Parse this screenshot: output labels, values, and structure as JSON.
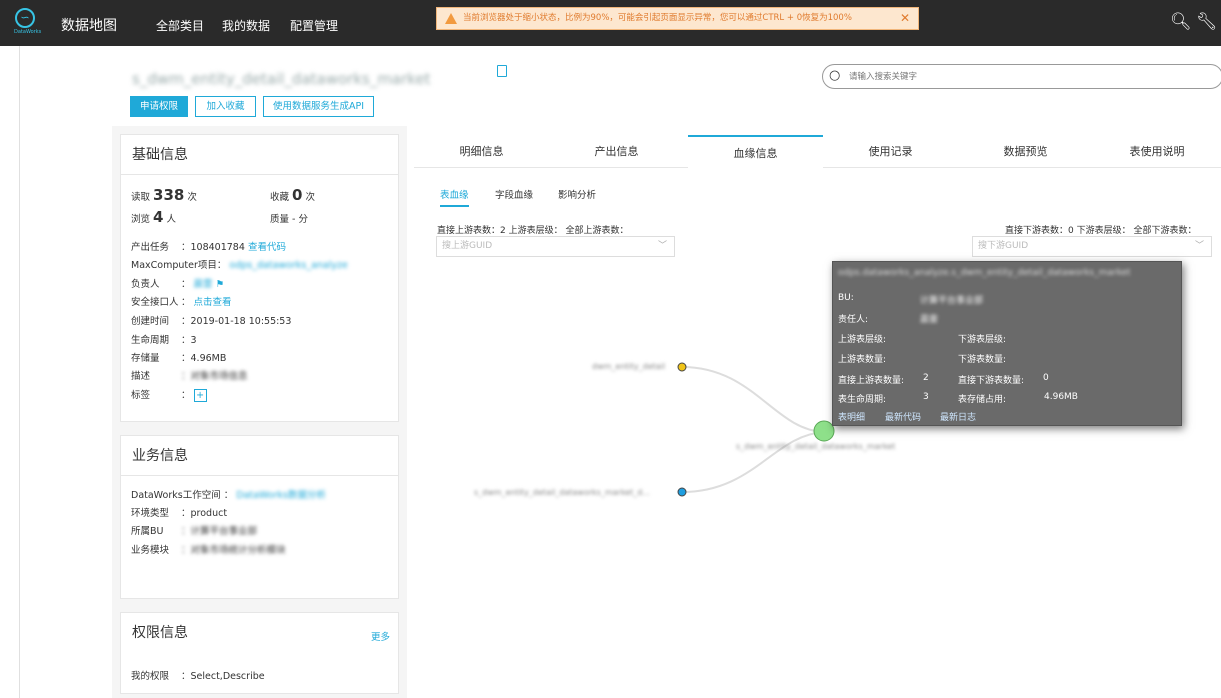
{
  "app": {
    "title": "数据地图",
    "logo_text": "DataWorks"
  },
  "nav": [
    "全部类目",
    "我的数据",
    "配置管理"
  ],
  "warning": "当前浏览器处于缩小状态，比例为90%，可能会引起页面显示异常，您可以通过CTRL + 0恢复为100%",
  "table_name": "s_dwm_entity_detail_dataworks_market",
  "buttons": {
    "apply": "申请权限",
    "collect": "加入收藏",
    "api": "使用数据服务生成API"
  },
  "search": {
    "placeholder": "请输入搜索关键字"
  },
  "basic": {
    "title": "基础信息",
    "read_label": "读取",
    "read_value": "338",
    "read_unit": "次",
    "collect_label": "收藏",
    "collect_value": "0",
    "collect_unit": "次",
    "browse_label": "浏览",
    "browse_value": "4",
    "browse_unit": "人",
    "quality_label": "质量",
    "quality_value": "- 分",
    "rows": [
      {
        "label": "产出任务",
        "value": "：108401784",
        "link": "查看代码"
      },
      {
        "label": "MaxComputer项目",
        "value": "：",
        "link": "odps_dataworks_analyze"
      },
      {
        "label": "负责人",
        "value": "：",
        "link": "晨雷"
      },
      {
        "label": "安全接口人",
        "value": "：",
        "link": "点击查看"
      },
      {
        "label": "创建时间",
        "value": "：2019-01-18 10:55:53",
        "link": ""
      },
      {
        "label": "生命周期",
        "value": "：3",
        "link": ""
      },
      {
        "label": "存储量",
        "value": "：4.96MB",
        "link": ""
      },
      {
        "label": "描述",
        "value": "：对象市场信息",
        "link": ""
      },
      {
        "label": "标签",
        "value": "：",
        "link": ""
      }
    ]
  },
  "business": {
    "title": "业务信息",
    "workspace_label": "DataWorks工作空间 ：",
    "workspace_value": "DataWorks数据分析",
    "env_label": "环境类型",
    "env_value": "：product",
    "bu_label": "所属BU",
    "bu_value": "：计算平台事业部",
    "module_label": "业务模块",
    "module_value": "：对象市场统计分析模块"
  },
  "permission": {
    "title": "权限信息",
    "more": "更多",
    "label": "我的权限",
    "value": "：Select,Describe"
  },
  "tabs": [
    "明细信息",
    "产出信息",
    "血缘信息",
    "使用记录",
    "数据预览",
    "表使用说明"
  ],
  "subtabs": [
    "表血缘",
    "字段血缘",
    "影响分析"
  ],
  "lineage": {
    "up_text": "直接上游表数：2  上游表层级：  全部上游表数：",
    "down_text": "直接下游表数：0  下游表层级：  全部下游表数：",
    "up_placeholder": "搜上游GUID",
    "down_placeholder": "搜下游GUID",
    "node_top": "dwm_entity_detail",
    "node_center": "s_dwm_entity_detail_dataworks_market",
    "node_bottom": "s_dwm_entity_detail_dataworks_market_d..."
  },
  "tooltip": {
    "title": "odps.dataworks_analyze.s_dwm_entity_detail_dataworks_market",
    "bu_label": "BU:",
    "bu_value": "计算平台事业部",
    "owner_label": "责任人:",
    "owner_value": "晨雷",
    "up_level_label": "上游表层级:",
    "down_level_label": "下游表层级:",
    "up_count_label": "上游表数量:",
    "down_count_label": "下游表数量:",
    "direct_up_label": "直接上游表数量:",
    "direct_up_value": "2",
    "direct_down_label": "直接下游表数量:",
    "direct_down_value": "0",
    "life_label": "表生命周期:",
    "life_value": "3",
    "storage_label": "表存储占用:",
    "storage_value": "4.96MB",
    "links": [
      "表明细",
      "最新代码",
      "最新日志"
    ]
  },
  "colors": {
    "accent": "#1fa9d8",
    "topbar": "#2a2a2a",
    "node_green": "#8ee08a",
    "node_yellow": "#f0c419",
    "node_blue": "#1e9ee0"
  }
}
